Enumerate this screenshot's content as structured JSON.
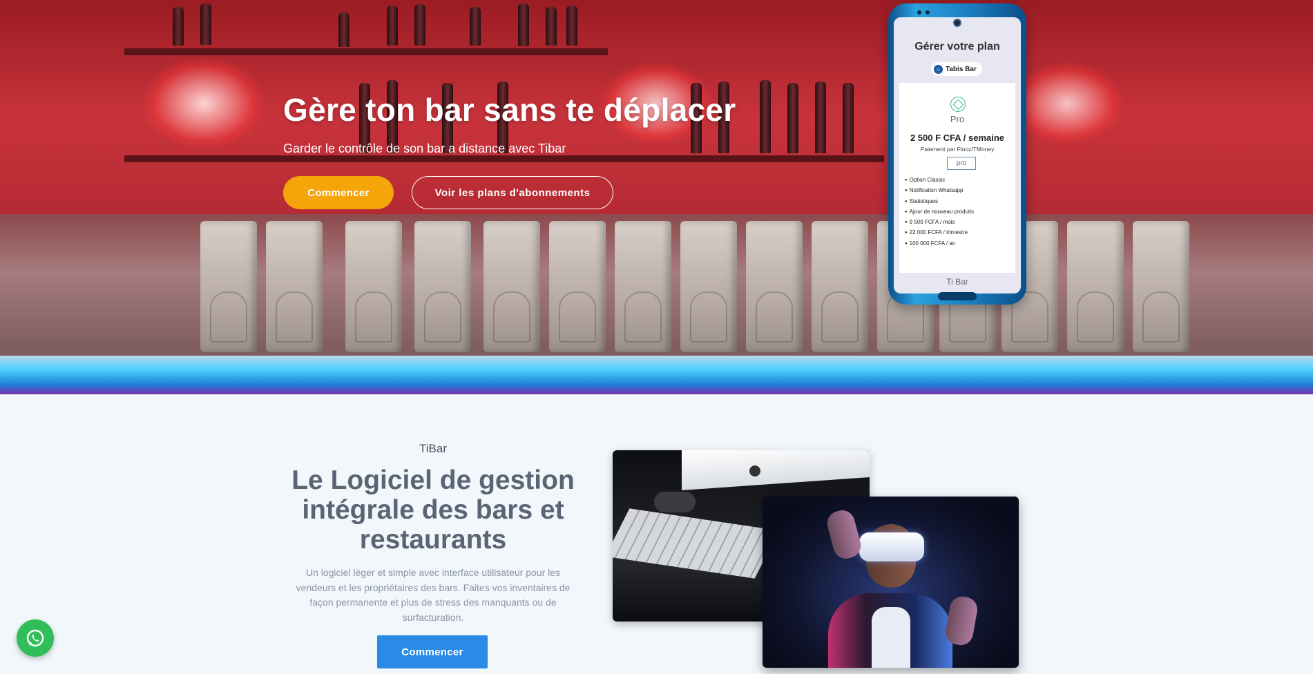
{
  "hero": {
    "title": "Gère ton bar sans te déplacer",
    "subtitle": "Garder le contrôle de son bar a distance avec Tibar",
    "primary_button": "Commencer",
    "secondary_button": "Voir les plans d'abonnements"
  },
  "phone": {
    "title": "Gérer votre plan",
    "bar_name": "Tabis Bar",
    "plan_name": "Pro",
    "price": "2 500 F CFA / semaine",
    "payment": "Paiement par Flooz/TMoney",
    "plan_button": "pro",
    "features": [
      "Option Classic",
      "Notification Whatsapp",
      "Statistiques",
      "Ajour de nouveau produits",
      "9 500 FCFA / mois",
      "22 000 FCFA / trimestre",
      "100 000 FCFA / an"
    ],
    "footer": "Ti Bar"
  },
  "intro": {
    "brand": "TiBar",
    "heading": "Le Logiciel de gestion intégrale des bars et restaurants",
    "description": "Un logiciel léger et simple avec interface utilisateur pour les vendeurs et les propriétaires des bars. Faites vos inventaires de façon permanente et plus de stress des manquants ou de surfacturation.",
    "button": "Commencer"
  },
  "colors": {
    "primary_orange": "#f5a40a",
    "primary_blue": "#2a8be6",
    "whatsapp_green": "#2fbe5a"
  },
  "icons": {
    "whatsapp": "whatsapp-icon",
    "bank": "bank-icon",
    "plan": "diamond-icon"
  }
}
